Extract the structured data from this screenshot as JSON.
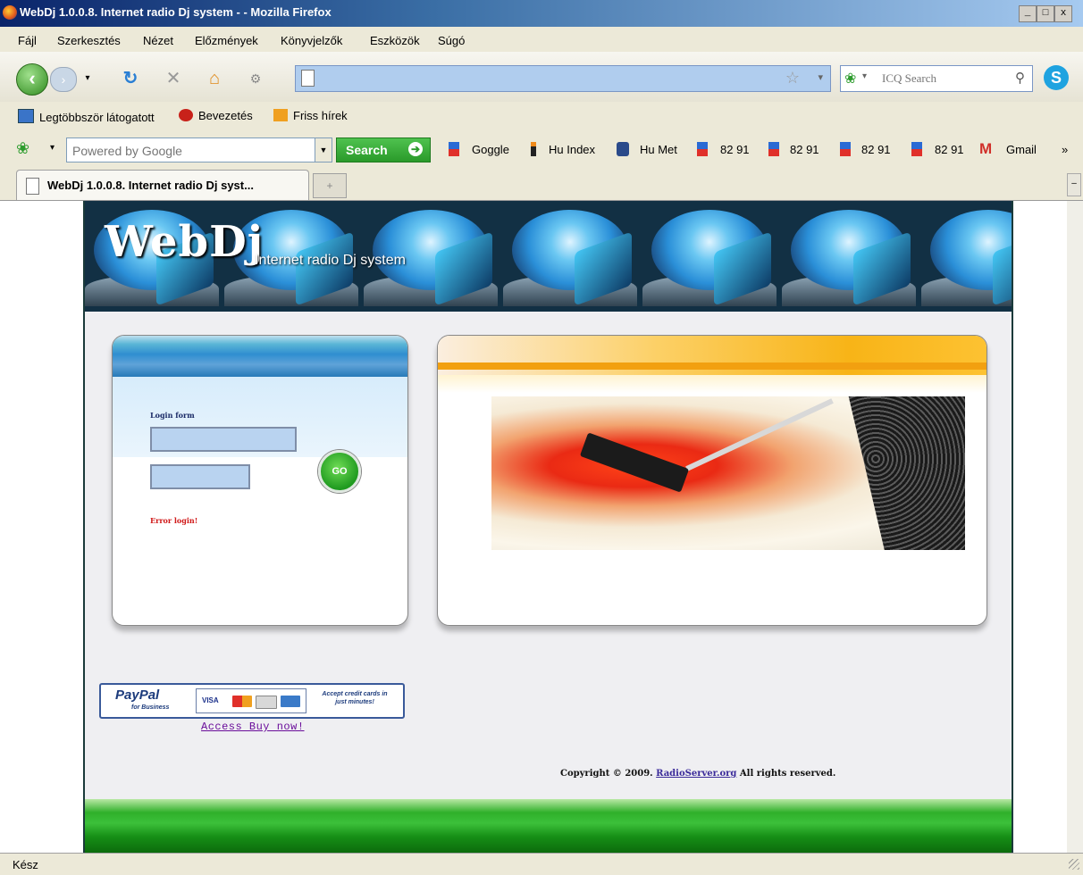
{
  "window": {
    "title": "WebDj 1.0.0.8. Internet radio Dj system - - Mozilla Firefox",
    "controls": [
      "_",
      "□",
      "x"
    ]
  },
  "menu": [
    "Fájl",
    "Szerkesztés",
    "Nézet",
    "Előzmények",
    "Könyvjelzők",
    "Eszközök",
    "Súgó"
  ],
  "nav": {
    "url": "",
    "search_placeholder": "ICQ Search"
  },
  "bookmarks": [
    "Legtöbbször látogatott",
    "Bevezetés",
    "Friss hírek"
  ],
  "google_toolbar": {
    "placeholder": "Powered by Google",
    "search_label": "Search",
    "links": [
      "Goggle",
      "Hu Index",
      "Hu Met",
      "82 91",
      "82 91",
      "82 91",
      "82 91",
      "Gmail"
    ],
    "more": "»"
  },
  "tab": {
    "label": "WebDj 1.0.0.8. Internet radio Dj syst...",
    "new_tab": "+"
  },
  "page": {
    "brand": "WebDj",
    "brand_sub": "Internet radio Dj system",
    "login": {
      "form_label": "Login form",
      "go_label": "GO",
      "error": "Error login!"
    },
    "paypal": {
      "logo": "PayPal",
      "sub": "for Business",
      "visa": "VISA",
      "note": "Accept credit cards in just minutes!"
    },
    "buy_link": "Access Buy now!",
    "copyright_prefix": "Copyright © 2009.",
    "copyright_link": "RadioServer.org",
    "copyright_suffix": "All rights reserved."
  },
  "status": "Kész",
  "colors": {
    "accent_green": "#2a9a2a",
    "login_header": "#2f8ed0",
    "main_header": "#f8b417",
    "error_red": "#d01818"
  }
}
